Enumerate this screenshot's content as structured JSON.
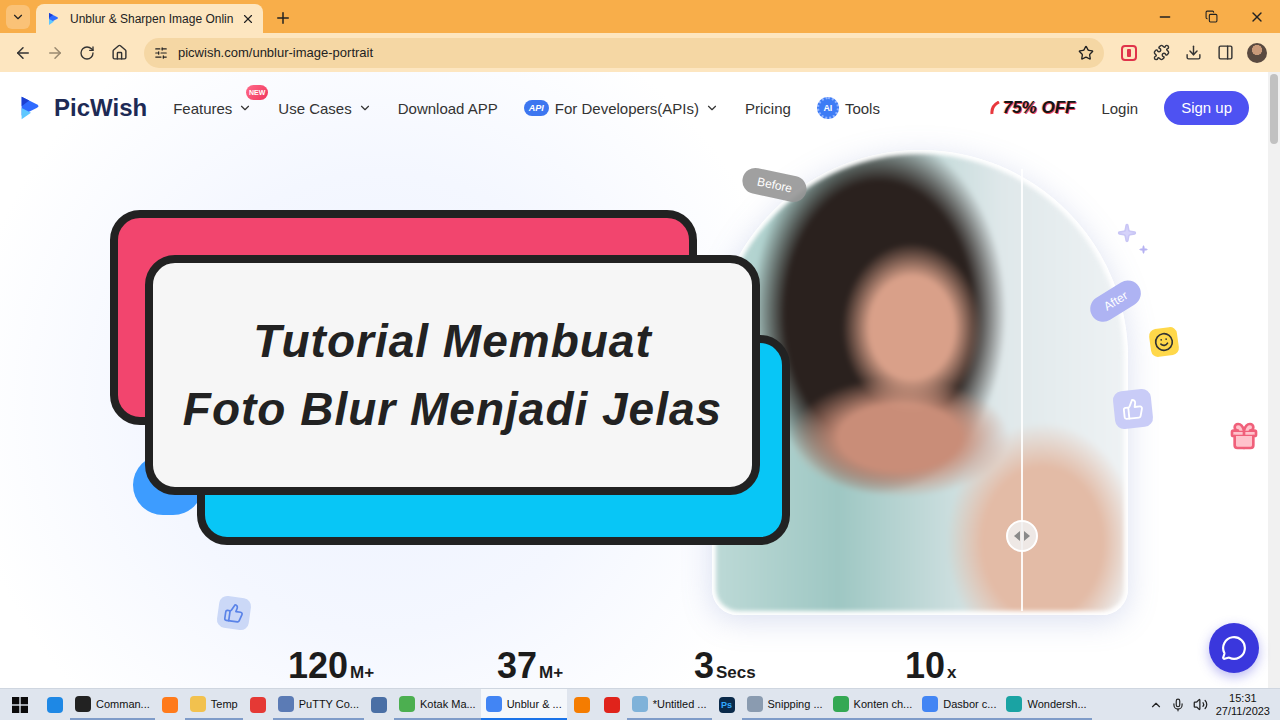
{
  "browser": {
    "tabs": [
      {
        "label": "Unblur & Sharpen Image Onlin",
        "selected": true
      }
    ],
    "url": "picwish.com/unblur-image-portrait"
  },
  "nav": {
    "logo": "PicWish",
    "items": [
      {
        "label": "Features",
        "badge": "NEW",
        "dropdown": true
      },
      {
        "label": "Use Cases",
        "dropdown": true
      },
      {
        "label": "Download APP",
        "dropdown": false
      },
      {
        "label": "For Developers(APIs)",
        "tag": "API",
        "dropdown": true
      },
      {
        "label": "Pricing",
        "dropdown": false
      },
      {
        "label": "Tools",
        "tag": "AI",
        "dropdown": false
      }
    ],
    "promo": "75% OFF",
    "login": "Login",
    "signup": "Sign up"
  },
  "hero": {
    "overlay_title": [
      "Tutorial Membuat",
      "Foto Blur Menjadi Jelas"
    ],
    "before_label": "Before",
    "after_label": "After",
    "compare_level": 0.75
  },
  "stats": [
    {
      "value": "120",
      "unit": "M+"
    },
    {
      "value": "37",
      "unit": "M+"
    },
    {
      "value": "3",
      "unit": "Secs"
    },
    {
      "value": "10",
      "unit": "x"
    }
  ],
  "taskbar": {
    "items": [
      {
        "kind": "app",
        "color": "#1e88e5",
        "selected": false
      },
      {
        "kind": "window",
        "label": "Comman...",
        "color": "#222222",
        "selected": false
      },
      {
        "kind": "app",
        "color": "#ff7a1a",
        "selected": false
      },
      {
        "kind": "window",
        "label": "Temp",
        "color": "#f2c14e",
        "selected": false
      },
      {
        "kind": "app",
        "color": "#e53935",
        "selected": false
      },
      {
        "kind": "window",
        "label": "PuTTY Co...",
        "color": "#5b7bb5",
        "selected": false
      },
      {
        "kind": "app",
        "color": "#4a6fa5",
        "selected": false
      },
      {
        "kind": "window",
        "label": "Kotak Ma...",
        "color": "#4caf50",
        "selected": false
      },
      {
        "kind": "window",
        "label": "Unblur & ...",
        "color": "#4285f4",
        "selected": true
      },
      {
        "kind": "app",
        "color": "#f57c00",
        "selected": false
      },
      {
        "kind": "app",
        "color": "#e0231b",
        "selected": false
      },
      {
        "kind": "window",
        "label": "*Untitled ...",
        "color": "#7fb2d9",
        "selected": false
      },
      {
        "kind": "app",
        "color": "#0b2a4a",
        "glyph": "Ps",
        "selected": false
      },
      {
        "kind": "window",
        "label": "Snipping ...",
        "color": "#8a9bb0",
        "selected": false
      },
      {
        "kind": "window",
        "label": "Konten ch...",
        "color": "#34a853",
        "selected": false
      },
      {
        "kind": "window",
        "label": "Dasbor c...",
        "color": "#4285f4",
        "selected": false
      },
      {
        "kind": "window",
        "label": "Wondersh...",
        "color": "#1aa3a3",
        "selected": false
      }
    ],
    "clock": {
      "time": "15:31",
      "date": "27/11/2023"
    }
  }
}
